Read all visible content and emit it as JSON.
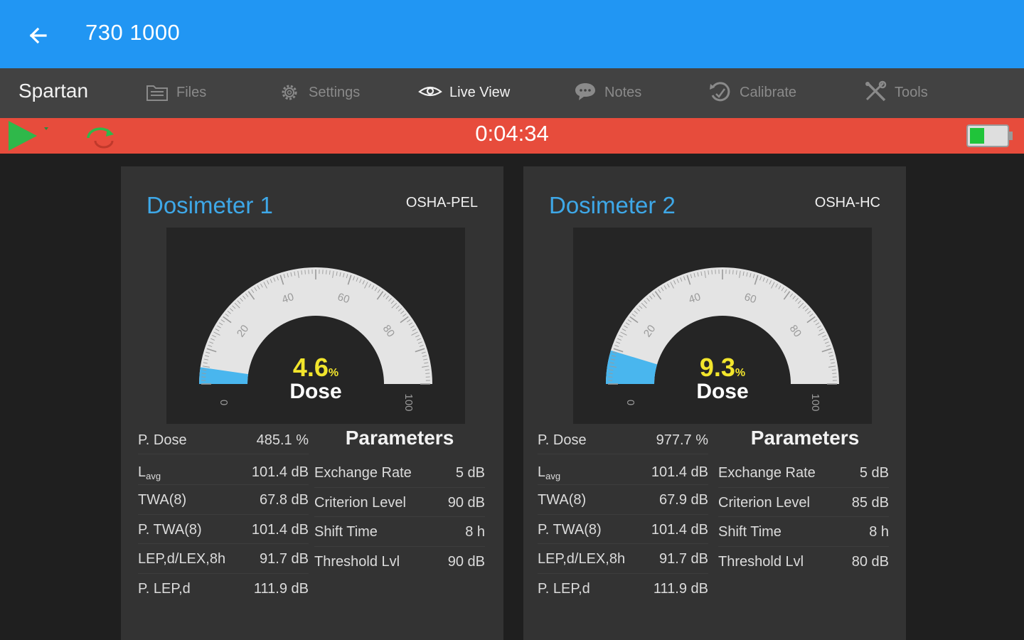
{
  "appbar": {
    "title": "730 1000",
    "color": "#2196f3"
  },
  "navbar": {
    "brand": "Spartan",
    "items": [
      {
        "label": "Files",
        "icon": "folder-icon",
        "active": false
      },
      {
        "label": "Settings",
        "icon": "gear-icon",
        "active": false
      },
      {
        "label": "Live View",
        "icon": "eye-icon",
        "active": true
      },
      {
        "label": "Notes",
        "icon": "speech-bubble-icon",
        "active": false
      },
      {
        "label": "Calibrate",
        "icon": "calibrate-icon",
        "active": false
      },
      {
        "label": "Tools",
        "icon": "tools-icon",
        "active": false
      }
    ]
  },
  "status": {
    "timer": "0:04:34",
    "color": "#e74c3c",
    "play_icon": "play-icon",
    "reset_icon": "reset-icon",
    "battery_icon": "battery-icon",
    "battery_level": 0.4
  },
  "dosimeters": [
    {
      "title": "Dosimeter 1",
      "standard": "OSHA-PEL",
      "gauge": {
        "value": "4.6",
        "unit": "%",
        "caption": "Dose",
        "fraction": 0.046,
        "ticks": [
          "0",
          "20",
          "40",
          "60",
          "80",
          "100"
        ]
      },
      "stats": [
        {
          "label": "P. Dose",
          "value": "485.1 %"
        },
        {
          "label": "L",
          "label_sub": "avg",
          "value": "101.4 dB"
        },
        {
          "label": "TWA(8)",
          "value": "67.8 dB"
        },
        {
          "label": "P. TWA(8)",
          "value": "101.4 dB"
        },
        {
          "label": "LEP,d/LEX,8h",
          "value": "91.7 dB"
        },
        {
          "label": "P. LEP,d",
          "value": "111.9 dB"
        }
      ],
      "params_title": "Parameters",
      "params": [
        {
          "label": "Exchange Rate",
          "value": "5 dB"
        },
        {
          "label": "Criterion Level",
          "value": "90 dB"
        },
        {
          "label": "Shift Time",
          "value": "8 h"
        },
        {
          "label": "Threshold Lvl",
          "value": "90 dB"
        }
      ]
    },
    {
      "title": "Dosimeter 2",
      "standard": "OSHA-HC",
      "gauge": {
        "value": "9.3",
        "unit": "%",
        "caption": "Dose",
        "fraction": 0.093,
        "ticks": [
          "0",
          "20",
          "40",
          "60",
          "80",
          "100"
        ]
      },
      "stats": [
        {
          "label": "P. Dose",
          "value": "977.7 %"
        },
        {
          "label": "L",
          "label_sub": "avg",
          "value": "101.4 dB"
        },
        {
          "label": "TWA(8)",
          "value": "67.9 dB"
        },
        {
          "label": "P. TWA(8)",
          "value": "101.4 dB"
        },
        {
          "label": "LEP,d/LEX,8h",
          "value": "91.7 dB"
        },
        {
          "label": "P. LEP,d",
          "value": "111.9 dB"
        }
      ],
      "params_title": "Parameters",
      "params": [
        {
          "label": "Exchange Rate",
          "value": "5 dB"
        },
        {
          "label": "Criterion Level",
          "value": "85 dB"
        },
        {
          "label": "Shift Time",
          "value": "8 h"
        },
        {
          "label": "Threshold Lvl",
          "value": "80 dB"
        }
      ]
    }
  ]
}
